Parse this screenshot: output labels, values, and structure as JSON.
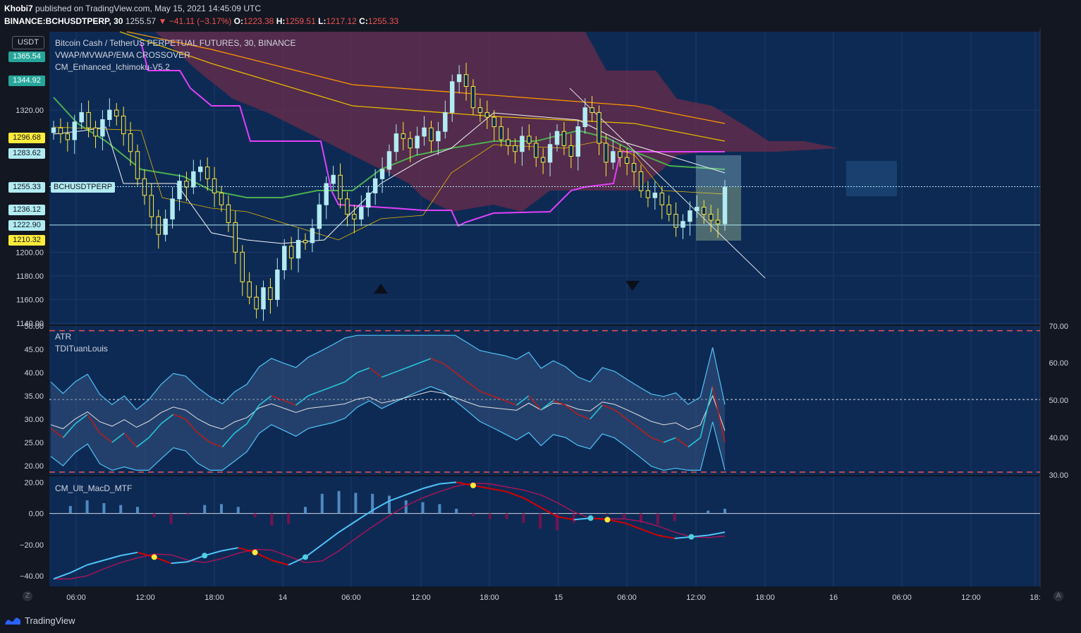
{
  "header": {
    "user": "Khobi7",
    "published": " published on TradingView.com, May 15, 2021 14:45:09 UTC",
    "symbol": "BINANCE:BCHUSDTPERP",
    "interval": ", 30",
    "last": "1255.57",
    "change": "▼ −41.11 (−3.17%)",
    "o_label": "O:",
    "o": "1223.38",
    "h_label": "H:",
    "h": "1259.51",
    "l_label": "L:",
    "l": "1217.12",
    "c_label": "C:",
    "c": "1255.33"
  },
  "legend": {
    "title": "Bitcoin Cash / TetherUS PERPETUAL FUTURES, 30, BINANCE",
    "ind1": "VWAP/MVWAP/EMA CROSSOVER",
    "ind2": "CM_Enhanced_Ichimoku-V5.2",
    "currency": "USDT",
    "symbol_tag": "BCHUSDTPERP"
  },
  "atr_legend": {
    "l1": "ATR",
    "l2": "TDITuanLouis"
  },
  "macd_legend": {
    "l1": "CM_Ult_MacD_MTF"
  },
  "price_labels": [
    {
      "text": "1365.54",
      "price": 1365.54,
      "bg": "#26a69a",
      "fg": "#ffffff"
    },
    {
      "text": "1344.92",
      "price": 1344.92,
      "bg": "#26a69a",
      "fg": "#ffffff"
    },
    {
      "text": "1296.68",
      "price": 1296.68,
      "bg": "#ffeb3b",
      "fg": "#131722"
    },
    {
      "text": "1283.62",
      "price": 1283.62,
      "bg": "#b2ebf2",
      "fg": "#131722"
    },
    {
      "text": "1255.33",
      "price": 1255.33,
      "bg": "#b2ebf2",
      "fg": "#131722"
    },
    {
      "text": "1236.12",
      "price": 1236.12,
      "bg": "#b2ebf2",
      "fg": "#131722"
    },
    {
      "text": "1222.90",
      "price": 1222.9,
      "bg": "#b2ebf2",
      "fg": "#131722"
    },
    {
      "text": "1210.32",
      "price": 1210.32,
      "bg": "#ffeb3b",
      "fg": "#131722"
    }
  ],
  "footer": {
    "brand": "TradingView",
    "left_btn": "Z",
    "right_btn": "A"
  },
  "colors": {
    "bg": "#131722",
    "pane": "#0d2a55",
    "grid": "#1c3a66",
    "bullCandle": "#b2ebf2",
    "bearCandle": "#ffeb3b",
    "cloud": "#6b2c49",
    "vwap": "#4caf50",
    "emaOrange": "#ff9800",
    "emaGold": "#e6b800",
    "magenta": "#e040fb",
    "signal": "#b71c1c",
    "macdLine": "#4fc3f7"
  },
  "chart_data": [
    {
      "type": "candlestick",
      "title": "Bitcoin Cash / TetherUS PERPETUAL FUTURES, 30, BINANCE",
      "x_ticks": [
        "06:00",
        "12:00",
        "18:00",
        "14",
        "06:00",
        "12:00",
        "18:00",
        "15",
        "06:00",
        "12:00",
        "18:00",
        "16",
        "06:00",
        "12:00",
        "18:"
      ],
      "y_ticks": [
        "1320.00",
        "1200.00",
        "1180.00",
        "1160.00",
        "1140.00"
      ],
      "ylim": [
        1140,
        1385
      ],
      "candles_close": [
        1305,
        1300,
        1295,
        1310,
        1318,
        1305,
        1298,
        1312,
        1320,
        1315,
        1300,
        1285,
        1262,
        1248,
        1230,
        1215,
        1228,
        1245,
        1260,
        1255,
        1268,
        1272,
        1262,
        1250,
        1240,
        1225,
        1200,
        1175,
        1162,
        1152,
        1170,
        1160,
        1185,
        1205,
        1195,
        1210,
        1208,
        1220,
        1240,
        1258,
        1265,
        1245,
        1232,
        1228,
        1238,
        1250,
        1262,
        1270,
        1285,
        1300,
        1296,
        1288,
        1298,
        1305,
        1294,
        1302,
        1318,
        1344,
        1350,
        1340,
        1322,
        1318,
        1314,
        1306,
        1295,
        1290,
        1285,
        1298,
        1292,
        1280,
        1276,
        1291,
        1302,
        1290,
        1281,
        1306,
        1322,
        1318,
        1292,
        1276,
        1285,
        1280,
        1275,
        1268,
        1252,
        1246,
        1250,
        1240,
        1232,
        1221,
        1226,
        1235,
        1238,
        1232,
        1227,
        1224,
        1255
      ]
    },
    {
      "type": "line",
      "title": "ATR / TDITuanLouis",
      "y_ticks_left": [
        "50.00",
        "45.00",
        "40.00",
        "35.00",
        "30.00",
        "25.00",
        "20.00"
      ],
      "y_ticks_right": [
        "70.00",
        "60.00",
        "50.00",
        "40.00",
        "30.00"
      ],
      "ylim": [
        18,
        50
      ],
      "series": [
        {
          "values": [
            28,
            26,
            29,
            31,
            27,
            25,
            27,
            24,
            26,
            29,
            31,
            30,
            27,
            25,
            24,
            27,
            29,
            33,
            35,
            34,
            33,
            35,
            36,
            37,
            38,
            40,
            41,
            39,
            40,
            41,
            42,
            43,
            42,
            40,
            38,
            36,
            35,
            34,
            33,
            35,
            32,
            34,
            33,
            31,
            30,
            33,
            32,
            30,
            28,
            26,
            25,
            26,
            24,
            26,
            37,
            25
          ]
        }
      ]
    },
    {
      "type": "line",
      "title": "CM_Ult_MacD_MTF",
      "y_ticks": [
        "20.00",
        "0.00",
        "−20.00",
        "−40.00"
      ],
      "ylim": [
        -45,
        22
      ],
      "series": [
        {
          "values": [
            -42,
            -38,
            -33,
            -30,
            -27,
            -25,
            -28,
            -32,
            -31,
            -27,
            -24,
            -22,
            -25,
            -30,
            -33,
            -28,
            -20,
            -12,
            -5,
            2,
            8,
            12,
            16,
            19,
            20,
            18,
            16,
            14,
            10,
            4,
            -2,
            -4,
            -3,
            -4,
            -6,
            -10,
            -14,
            -16,
            -15,
            -14,
            -12
          ]
        }
      ]
    }
  ]
}
